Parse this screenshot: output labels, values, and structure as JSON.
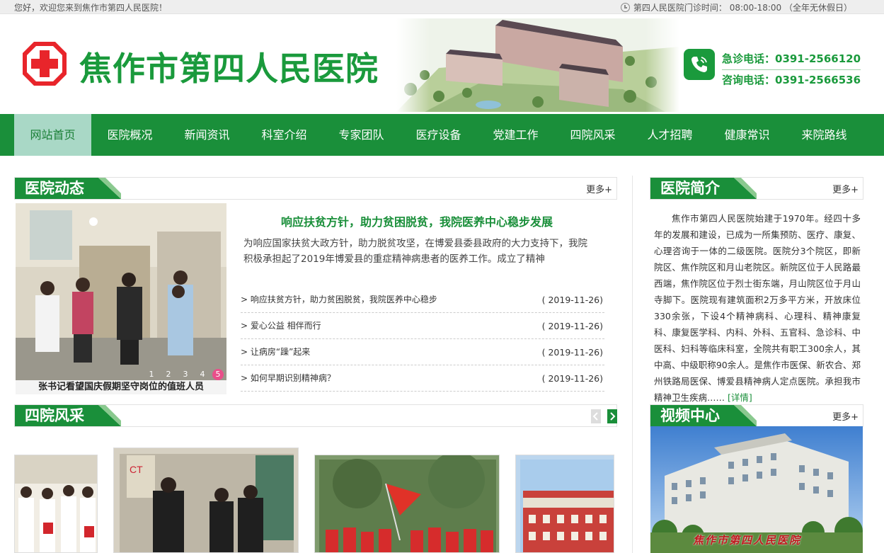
{
  "topbar": {
    "welcome": "您好，欢迎您来到焦作市第四人民医院！",
    "hours": "第四人民医院门诊时间： 08:00-18:00 （全年无休假日）"
  },
  "header": {
    "site_name": "焦作市第四人民医院",
    "emergency": "急诊电话：0391-2566120",
    "consult": "咨询电话：0391-2566536"
  },
  "nav": {
    "items": [
      "网站首页",
      "医院概况",
      "新闻资讯",
      "科室介绍",
      "专家团队",
      "医疗设备",
      "党建工作",
      "四院风采",
      "人才招聘",
      "健康常识",
      "来院路线"
    ]
  },
  "news": {
    "title": "医院动态",
    "more": "更多+",
    "carousel_dots": [
      "1",
      "2",
      "3",
      "4",
      "5"
    ],
    "caption": "张书记看望国庆假期坚守岗位的值班人员",
    "headline": "响应扶贫方针，助力贫困脱贫，我院医养中心稳步发展",
    "summary": "为响应国家扶贫大政方针，助力脱贫攻坚，在博爱县委县政府的大力支持下，我院积极承担起了2019年博爱县的重症精神病患者的医养工作。成立了精神",
    "list": [
      {
        "title": "> 响应扶贫方针，助力贫困脱贫，我院医养中心稳步",
        "date": "( 2019-11-26)"
      },
      {
        "title": "> 爱心公益 相伴而行",
        "date": "( 2019-11-26)"
      },
      {
        "title": "> 让病房“躁”起来",
        "date": "( 2019-11-26)"
      },
      {
        "title": "> 如何早期识别精神病？",
        "date": "( 2019-11-26)"
      }
    ]
  },
  "intro": {
    "title": "医院简介",
    "more": "更多+",
    "text": "焦作市第四人民医院始建于1970年。经四十多年的发展和建设，已成为一所集预防、医疗、康复、心理咨询于一体的二级医院。医院分3个院区，即新院区、焦作院区和月山老院区。新院区位于人民路最西端，焦作院区位于烈士街东端，月山院区位于月山寺脚下。医院现有建筑面积2万多平方米，开放床位330余张，下设4个精神病科、心理科、精神康复科、康复医学科、内科、外科、五官科、急诊科、中医科、妇科等临床科室，全院共有职工300余人，其中高、中级职称90余人。是焦作市医保、新农合、郑州铁路局医保、博爱县精神病人定点医院。承担我市精神卫生疾病……",
    "detail": "[详情]"
  },
  "gallery": {
    "title": "四院风采"
  },
  "video": {
    "title": "视频中心",
    "more": "更多+",
    "banner": "焦作市第四人民医院"
  },
  "colors": {
    "brand_green": "#1a8f3a",
    "nav_active": "#a9d8c6"
  }
}
